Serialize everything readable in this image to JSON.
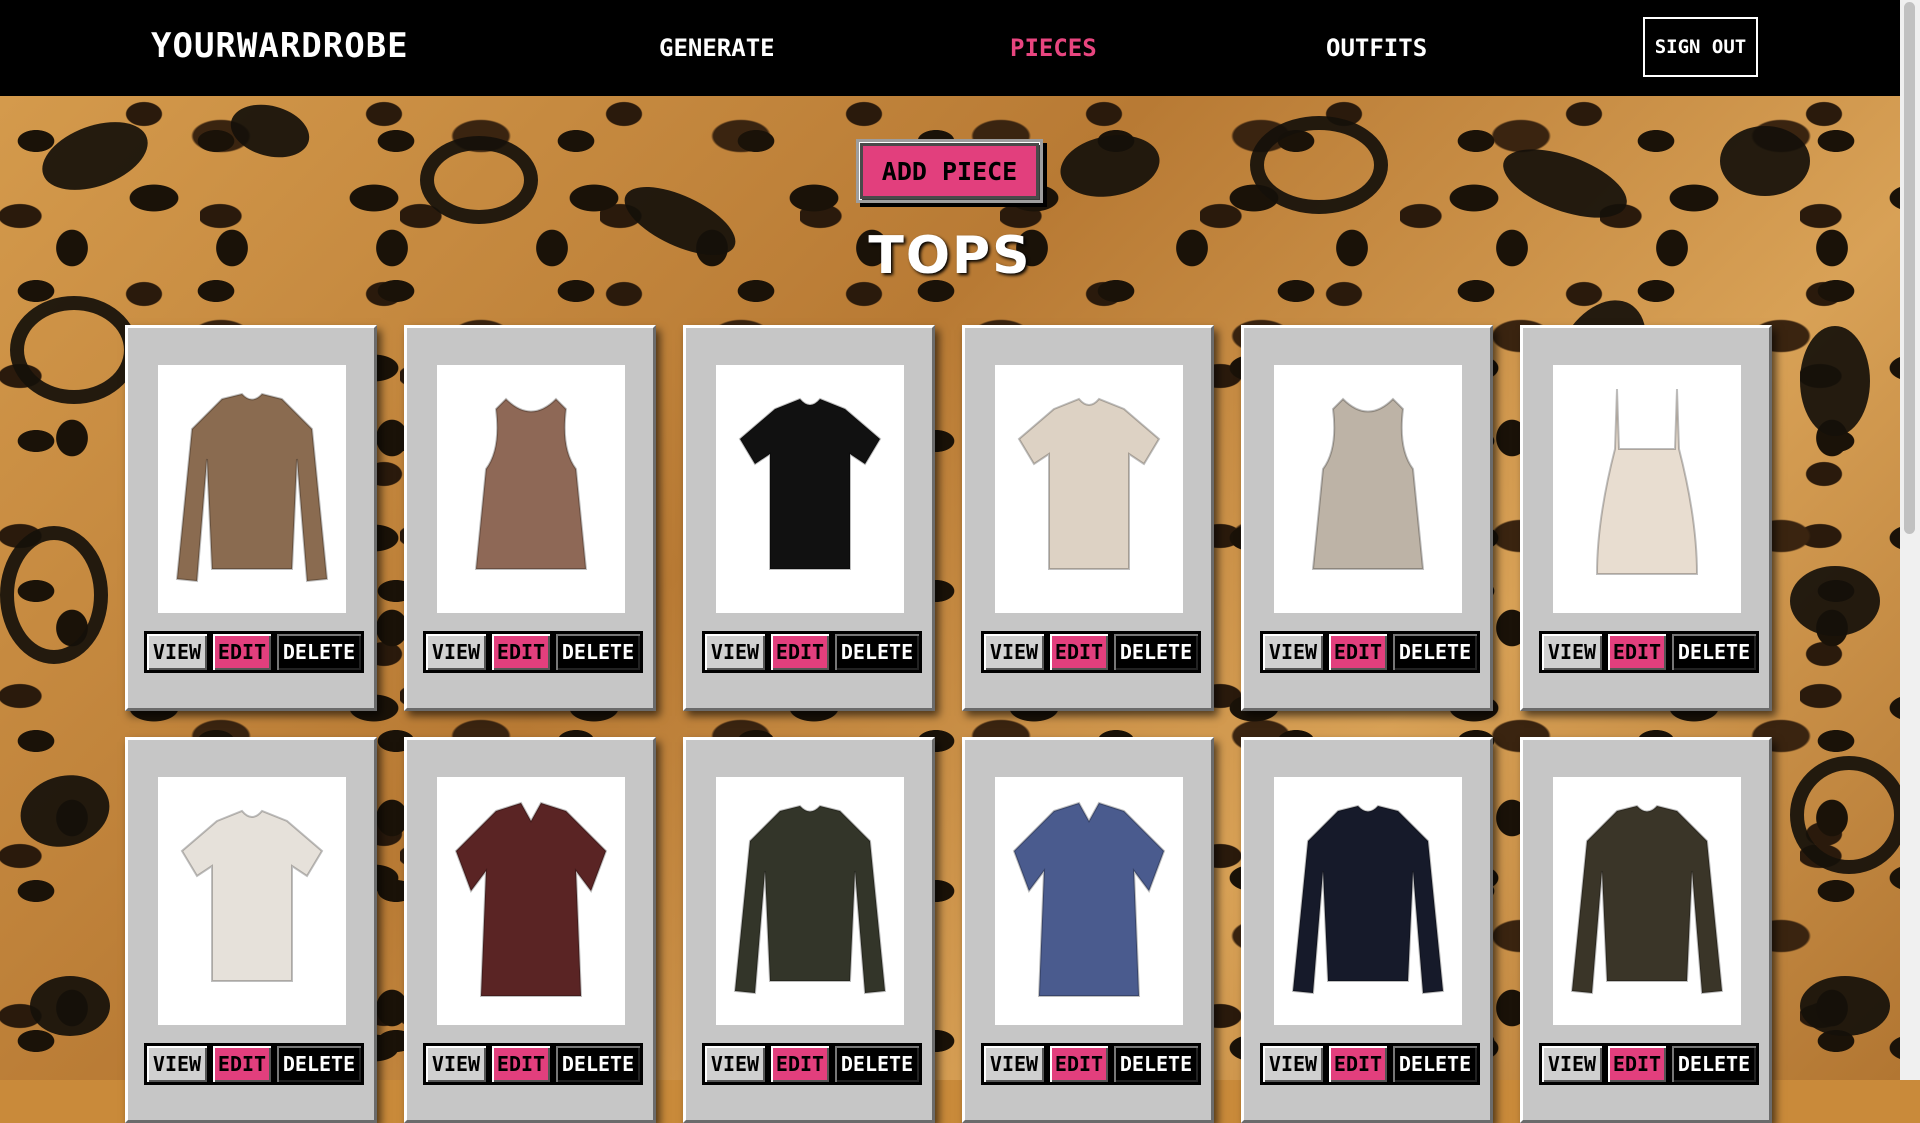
{
  "header": {
    "brand": "YOURWARDROBE",
    "nav": [
      {
        "label": "GENERATE",
        "active": false
      },
      {
        "label": "PIECES",
        "active": true
      },
      {
        "label": "OUTFITS",
        "active": false
      }
    ],
    "sign_out": "SIGN OUT"
  },
  "accent_color": "#e23f7d",
  "add_piece_label": "ADD PIECE",
  "section_title": "TOPS",
  "card_buttons": {
    "view": "VIEW",
    "edit": "EDIT",
    "delete": "DELETE"
  },
  "pieces": [
    {
      "icon": "leopard-long-sleeve-blouse-icon",
      "color": "#8a6b50"
    },
    {
      "icon": "brown-tank-top-icon",
      "color": "#8e6856"
    },
    {
      "icon": "black-tshirt-icon",
      "color": "#111111"
    },
    {
      "icon": "cream-twist-tee-icon",
      "color": "#ddd2c4"
    },
    {
      "icon": "beige-knit-vest-icon",
      "color": "#bdb3a6"
    },
    {
      "icon": "cream-camisole-icon",
      "color": "#e8ddd0"
    },
    {
      "icon": "howdy-crop-tee-icon",
      "color": "#e6e1da"
    },
    {
      "icon": "striped-button-shirt-icon",
      "color": "#5a2424"
    },
    {
      "icon": "olive-sweater-icon",
      "color": "#333529"
    },
    {
      "icon": "blue-silk-blouse-icon",
      "color": "#4a5b8e"
    },
    {
      "icon": "navy-long-sleeve-icon",
      "color": "#161a2a"
    },
    {
      "icon": "olive-henley-icon",
      "color": "#3a3528"
    }
  ]
}
